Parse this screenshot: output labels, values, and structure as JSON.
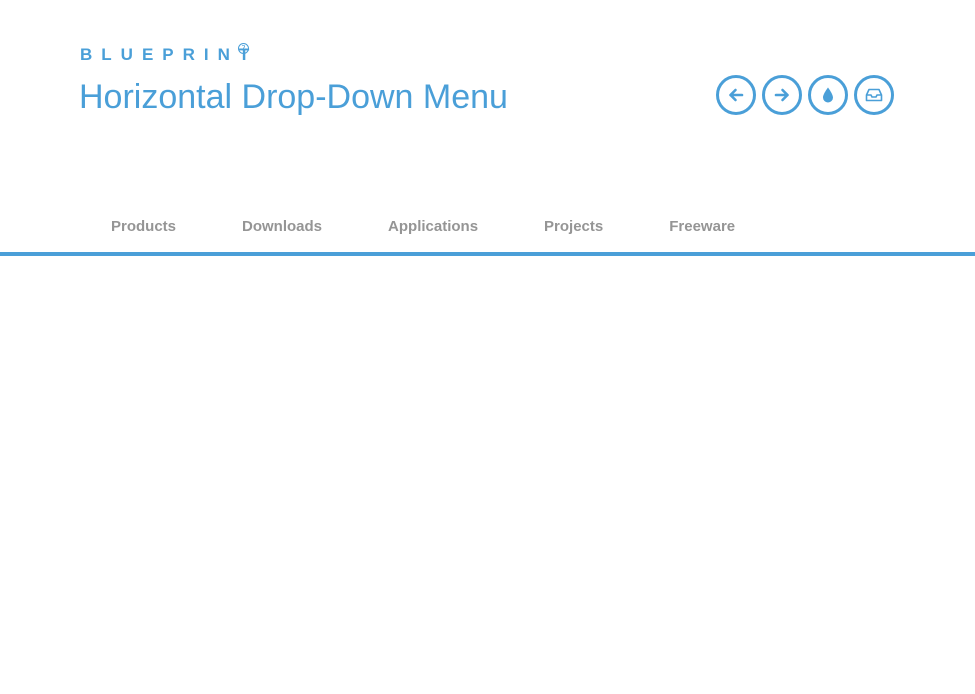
{
  "header": {
    "brand": "BLUEPRINT",
    "brand_help_glyph": "?",
    "title": "Horizontal Drop-Down Menu"
  },
  "toolbar": {
    "icons": [
      "arrow-left-icon",
      "arrow-right-icon",
      "drop-icon",
      "inbox-icon"
    ]
  },
  "nav": {
    "items": [
      {
        "label": "Products"
      },
      {
        "label": "Downloads"
      },
      {
        "label": "Applications"
      },
      {
        "label": "Projects"
      },
      {
        "label": "Freeware"
      }
    ]
  },
  "colors": {
    "accent": "#4a9fd8",
    "nav_text": "#959595",
    "background": "#ffffff"
  }
}
